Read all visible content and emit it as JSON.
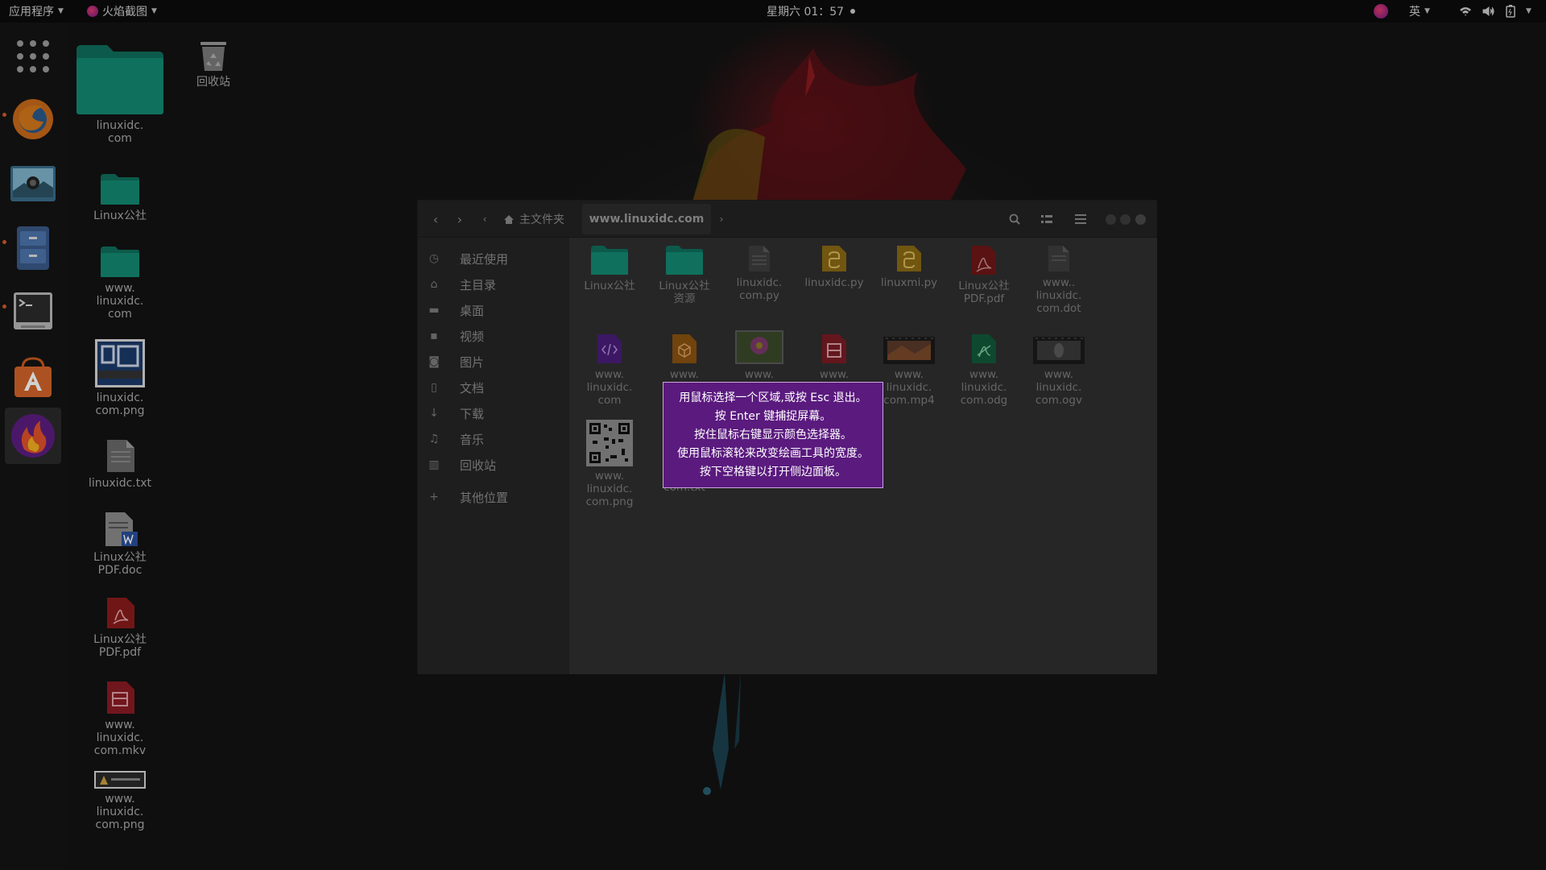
{
  "topbar": {
    "apps_label": "应用程序",
    "flameshot_label": "火焰截图",
    "clock": "星期六 01：57",
    "input_method": "英"
  },
  "dock": {
    "items": [
      {
        "name": "apps-grid-icon"
      },
      {
        "name": "firefox-icon"
      },
      {
        "name": "screenshot-app-icon"
      },
      {
        "name": "files-app-icon"
      },
      {
        "name": "terminal-icon"
      },
      {
        "name": "software-center-icon"
      },
      {
        "name": "flameshot-icon"
      }
    ]
  },
  "desktop": {
    "icons": [
      {
        "label": "linuxidc.\ncom",
        "type": "folder-large"
      },
      {
        "label": "回收站",
        "type": "trash"
      },
      {
        "label": "Linux公社",
        "type": "folder"
      },
      {
        "label": "www.\nlinuxidc.\ncom",
        "type": "folder"
      },
      {
        "label": "linuxidc.\ncom.png",
        "type": "image-logo"
      },
      {
        "label": "linuxidc.txt",
        "type": "text"
      },
      {
        "label": "Linux公社\nPDF.doc",
        "type": "doc"
      },
      {
        "label": "Linux公社\nPDF.pdf",
        "type": "pdf"
      },
      {
        "label": "www.\nlinuxidc.\ncom.mkv",
        "type": "video"
      },
      {
        "label": "www.\nlinuxidc.\ncom.png",
        "type": "image-banner"
      }
    ]
  },
  "file_manager": {
    "breadcrumb_home": "主文件夹",
    "breadcrumb_current": "www.linuxidc.com",
    "sidebar": [
      {
        "label": "最近使用",
        "icon": "clock-icon"
      },
      {
        "label": "主目录",
        "icon": "home-icon"
      },
      {
        "label": "桌面",
        "icon": "desktop-folder-icon"
      },
      {
        "label": "视频",
        "icon": "video-icon"
      },
      {
        "label": "图片",
        "icon": "camera-icon"
      },
      {
        "label": "文档",
        "icon": "document-icon"
      },
      {
        "label": "下载",
        "icon": "download-icon"
      },
      {
        "label": "音乐",
        "icon": "music-icon"
      },
      {
        "label": "回收站",
        "icon": "trash-icon"
      },
      {
        "label": "其他位置",
        "icon": "plus-icon"
      }
    ],
    "files": [
      {
        "label": "Linux公社",
        "type": "folder"
      },
      {
        "label": "Linux公社\n资源",
        "type": "folder"
      },
      {
        "label": "linuxidc.\ncom.py",
        "type": "text"
      },
      {
        "label": "linuxidc.py",
        "type": "python"
      },
      {
        "label": "linuxmi.py",
        "type": "python"
      },
      {
        "label": "Linux公社\nPDF.pdf",
        "type": "pdf"
      },
      {
        "label": "www..\nlinuxidc.\ncom.dot",
        "type": "text"
      },
      {
        "label": "www.\nlinuxidc.\ncom",
        "type": "html"
      },
      {
        "label": "www.",
        "type": "package"
      },
      {
        "label": "www.",
        "type": "image-flower"
      },
      {
        "label": "www.",
        "type": "presentation"
      },
      {
        "label": "www.\nlinuxidc.\ncom.mp4",
        "type": "video"
      },
      {
        "label": "www.\nlinuxidc.\ncom.odg",
        "type": "drawing"
      },
      {
        "label": "www.\nlinuxidc.\ncom.ogv",
        "type": "video-dark"
      },
      {
        "label": "www.\nlinuxidc.\ncom.png",
        "type": "qrcode"
      },
      {
        "label": "linuxmi.\ncom.txt",
        "type": "text"
      }
    ]
  },
  "hint": {
    "lines": [
      "用鼠标选择一个区域,或按 Esc 退出。",
      "按 Enter 键捕捉屏幕。",
      "按住鼠标右键显示颜色选择器。",
      "使用鼠标滚轮来改变绘画工具的宽度。",
      "按下空格键以打开侧边面板。"
    ]
  },
  "colors": {
    "hint_background": "#5a1a7e",
    "folder_teal": "#138a72",
    "accent_orange": "#d25a2a"
  }
}
